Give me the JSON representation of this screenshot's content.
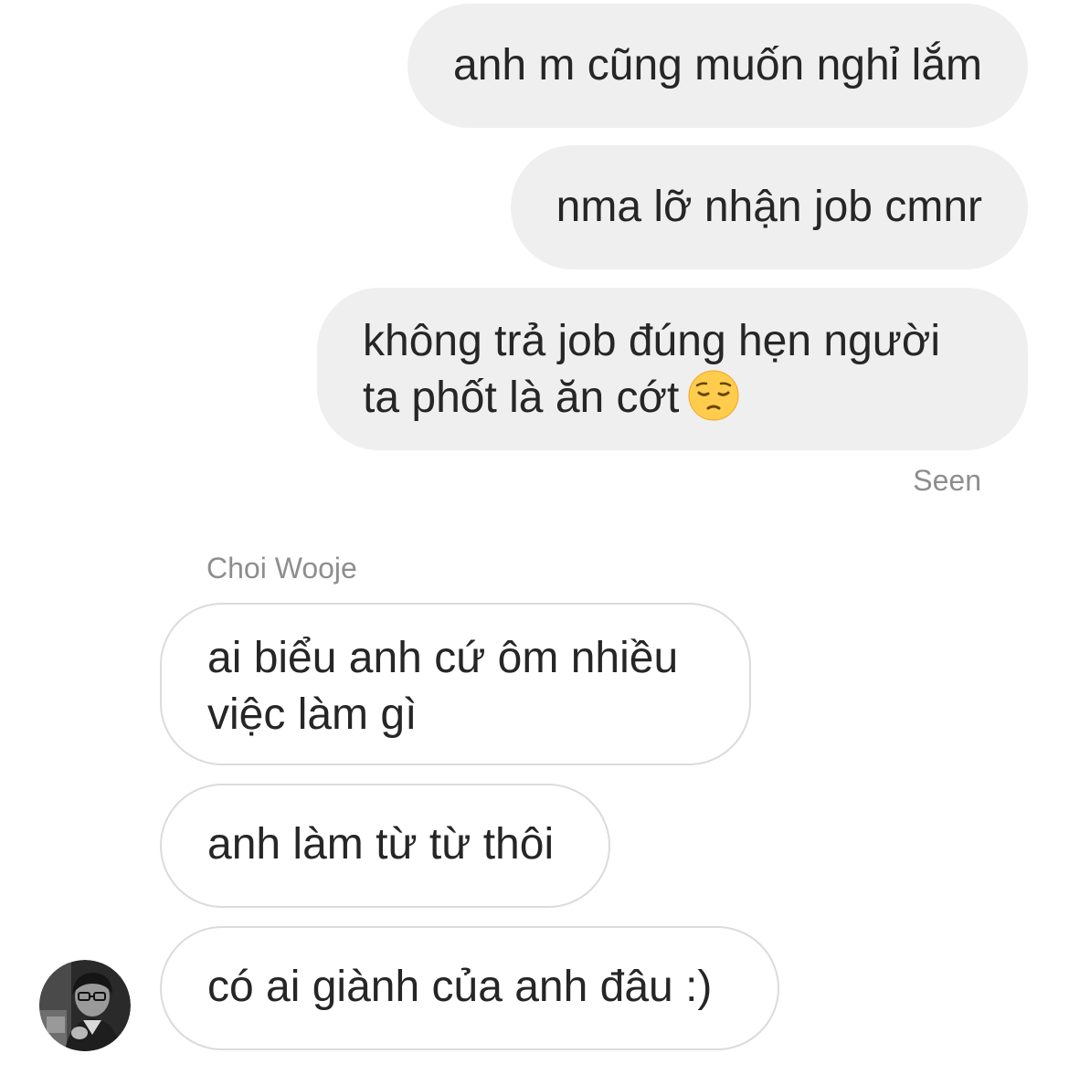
{
  "conversation": {
    "sent_messages": [
      {
        "text": "anh m cũng muốn nghỉ lắm"
      },
      {
        "text": "nma lỡ nhận job cmnr"
      },
      {
        "line1": "không trả job đúng hẹn người",
        "line2": "ta phốt là ăn cớt",
        "emoji": "pensive-face-emoji"
      }
    ],
    "seen_label": "Seen",
    "contact": {
      "name": "Choi Wooje",
      "avatar_icon": "profile-photo-avatar"
    },
    "received_messages": [
      {
        "line1": "ai biểu anh cứ ôm nhiều",
        "line2": "việc làm gì"
      },
      {
        "text": "anh làm từ từ thôi"
      },
      {
        "text": "có ai giành của anh đâu :)"
      }
    ]
  },
  "colors": {
    "sent_bubble": "#efefef",
    "received_border": "#dbdbdb",
    "text": "#262626",
    "meta_text": "#8e8e8e",
    "emoji_face": "#ffcc4d"
  }
}
